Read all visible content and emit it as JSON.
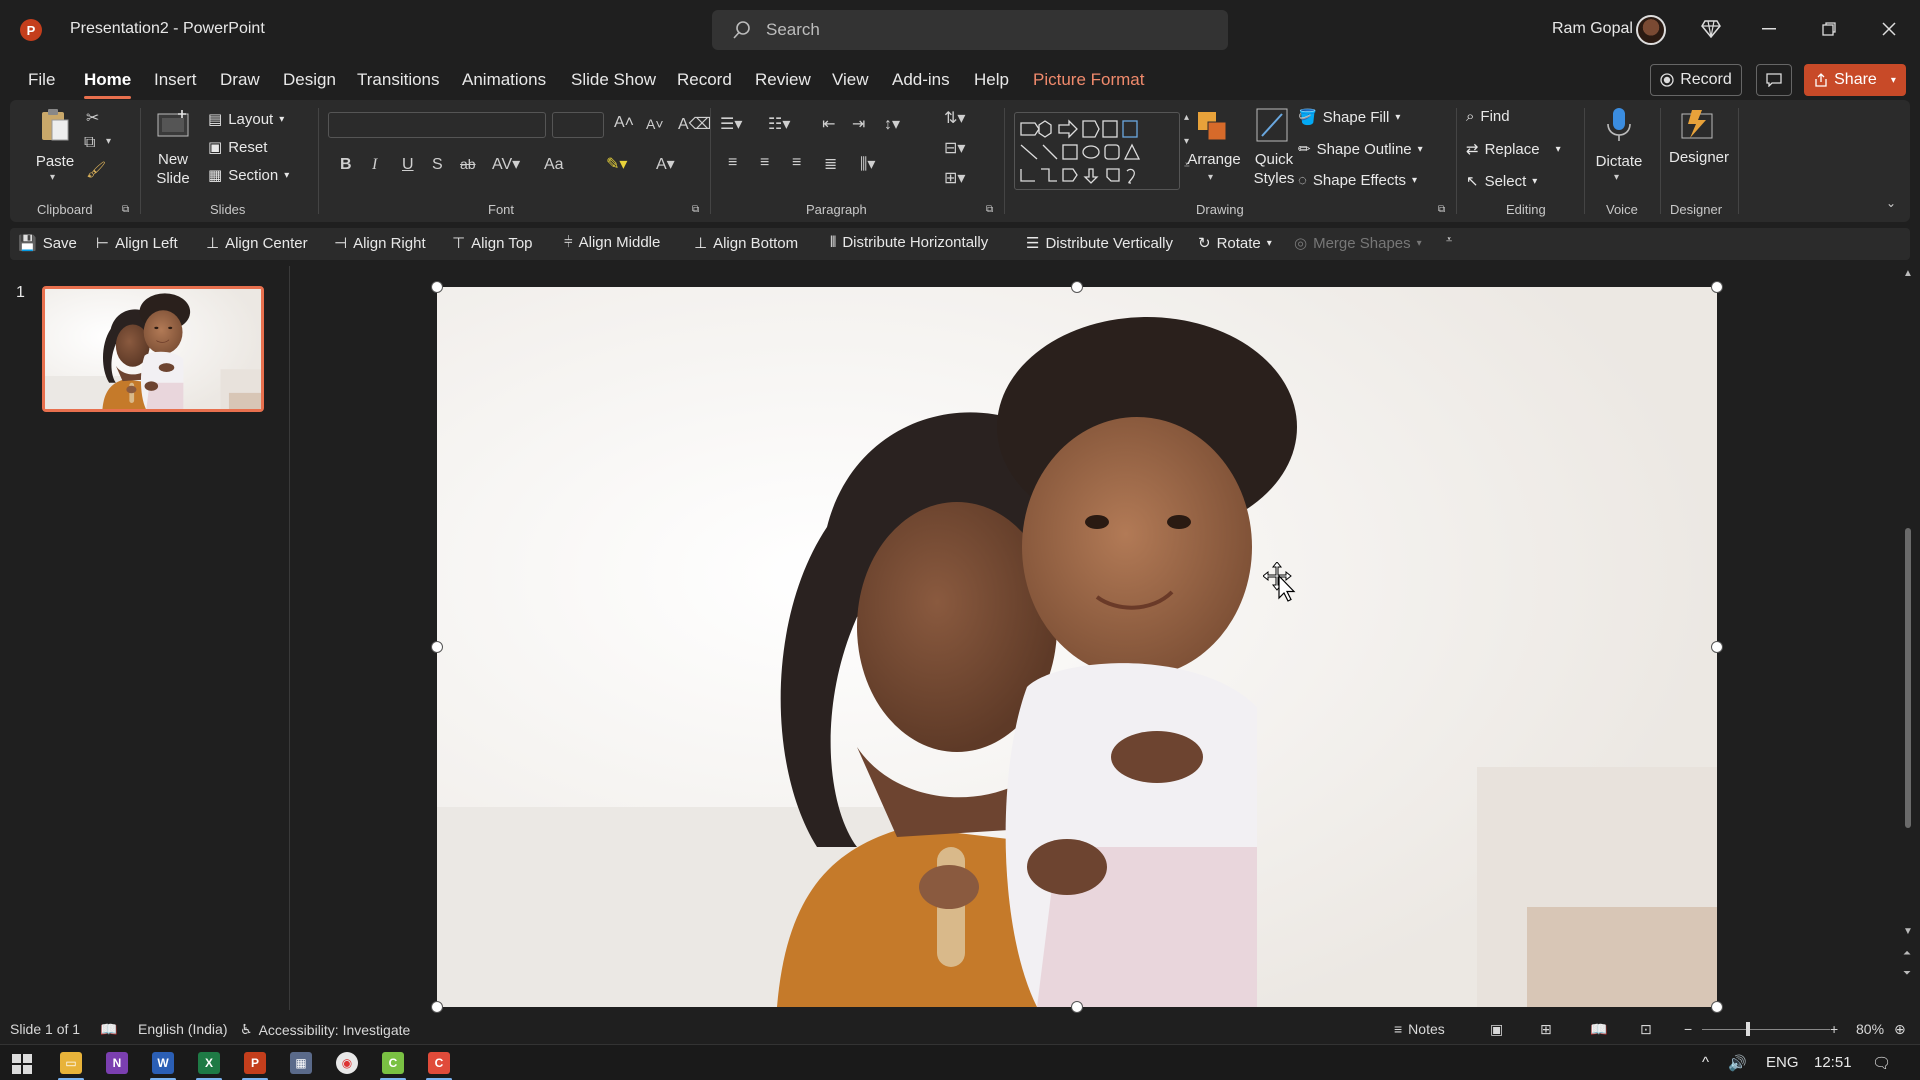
{
  "titlebar": {
    "app_logo": "P",
    "doc_title": "Presentation2  -  PowerPoint",
    "search_placeholder": "Search",
    "user_name": "Ram Gopal",
    "window_controls": [
      "minimize-icon",
      "restore-icon",
      "close-icon"
    ]
  },
  "menu": {
    "tabs": [
      "File",
      "Home",
      "Insert",
      "Draw",
      "Design",
      "Transitions",
      "Animations",
      "Slide Show",
      "Record",
      "Review",
      "View",
      "Add-ins",
      "Help",
      "Picture Format"
    ],
    "active": "Home",
    "record_label": "Record",
    "share_label": "Share"
  },
  "ribbon": {
    "clipboard": {
      "label": "Clipboard",
      "paste": "Paste"
    },
    "slides": {
      "label": "Slides",
      "new_slide": "New Slide",
      "layout": "Layout",
      "reset": "Reset",
      "section": "Section"
    },
    "font": {
      "label": "Font",
      "bold": "B",
      "italic": "I",
      "underline": "U",
      "shadow": "S",
      "strike": "ab",
      "case": "Aa"
    },
    "paragraph": {
      "label": "Paragraph"
    },
    "drawing": {
      "label": "Drawing",
      "arrange": "Arrange",
      "quick_styles": "Quick Styles",
      "shape_fill": "Shape Fill",
      "shape_outline": "Shape Outline",
      "shape_effects": "Shape Effects"
    },
    "editing": {
      "label": "Editing",
      "find": "Find",
      "replace": "Replace",
      "select": "Select"
    },
    "voice": {
      "label": "Voice",
      "dictate": "Dictate"
    },
    "designer": {
      "label": "Designer",
      "designer": "Designer"
    }
  },
  "qat": {
    "items": [
      "Save",
      "Align Left",
      "Align Center",
      "Align Right",
      "Align Top",
      "Align Middle",
      "Align Bottom",
      "Distribute Horizontally",
      "Distribute Vertically",
      "Rotate",
      "Merge Shapes"
    ]
  },
  "thumbs": {
    "slide_number": "1"
  },
  "statusbar": {
    "slide_info": "Slide 1 of 1",
    "language": "English (India)",
    "accessibility": "Accessibility: Investigate",
    "notes": "Notes",
    "zoom": "80%"
  },
  "taskbar": {
    "lang": "ENG",
    "time": "12:51"
  },
  "colors": {
    "accent": "#e8704e",
    "share": "#c84a28",
    "background": "#1f1f1f",
    "ribbon": "#2b2b2b"
  }
}
